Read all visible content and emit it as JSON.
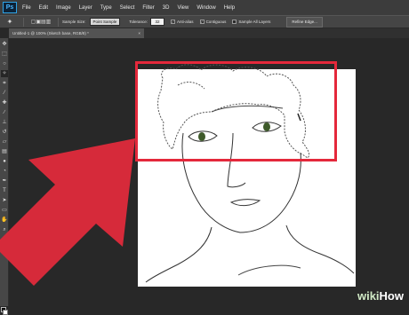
{
  "menubar": {
    "logo": "Ps",
    "items": [
      "File",
      "Edit",
      "Image",
      "Layer",
      "Type",
      "Select",
      "Filter",
      "3D",
      "View",
      "Window",
      "Help"
    ]
  },
  "options": {
    "sample_size_label": "Sample Size:",
    "sample_size_value": "Point Sample",
    "tolerance_label": "Tolerance:",
    "tolerance_value": "32",
    "antialias_label": "Anti-alias",
    "contiguous_label": "Contiguous",
    "sample_all_layers_label": "Sample All Layers",
    "refine_edge_label": "Refine Edge..."
  },
  "document": {
    "tab_title": "Untitled-1 @ 100% (Sketch base, RGB/8) *",
    "close": "×"
  },
  "toolbar": {
    "tools": [
      "move-icon",
      "marquee-icon",
      "lasso-icon",
      "quick-select-icon",
      "crop-icon",
      "eyedropper-icon",
      "healing-icon",
      "brush-icon",
      "clone-stamp-icon",
      "history-brush-icon",
      "eraser-icon",
      "gradient-icon",
      "blur-icon",
      "dodge-icon",
      "pen-icon",
      "type-icon",
      "path-select-icon",
      "shape-icon",
      "hand-icon",
      "zoom-icon"
    ],
    "type_glyph": "T"
  },
  "colors": {
    "highlight": "#e4283b",
    "accent": "#2fa3e6"
  },
  "watermark": {
    "wiki": "wiki",
    "how": "How"
  }
}
